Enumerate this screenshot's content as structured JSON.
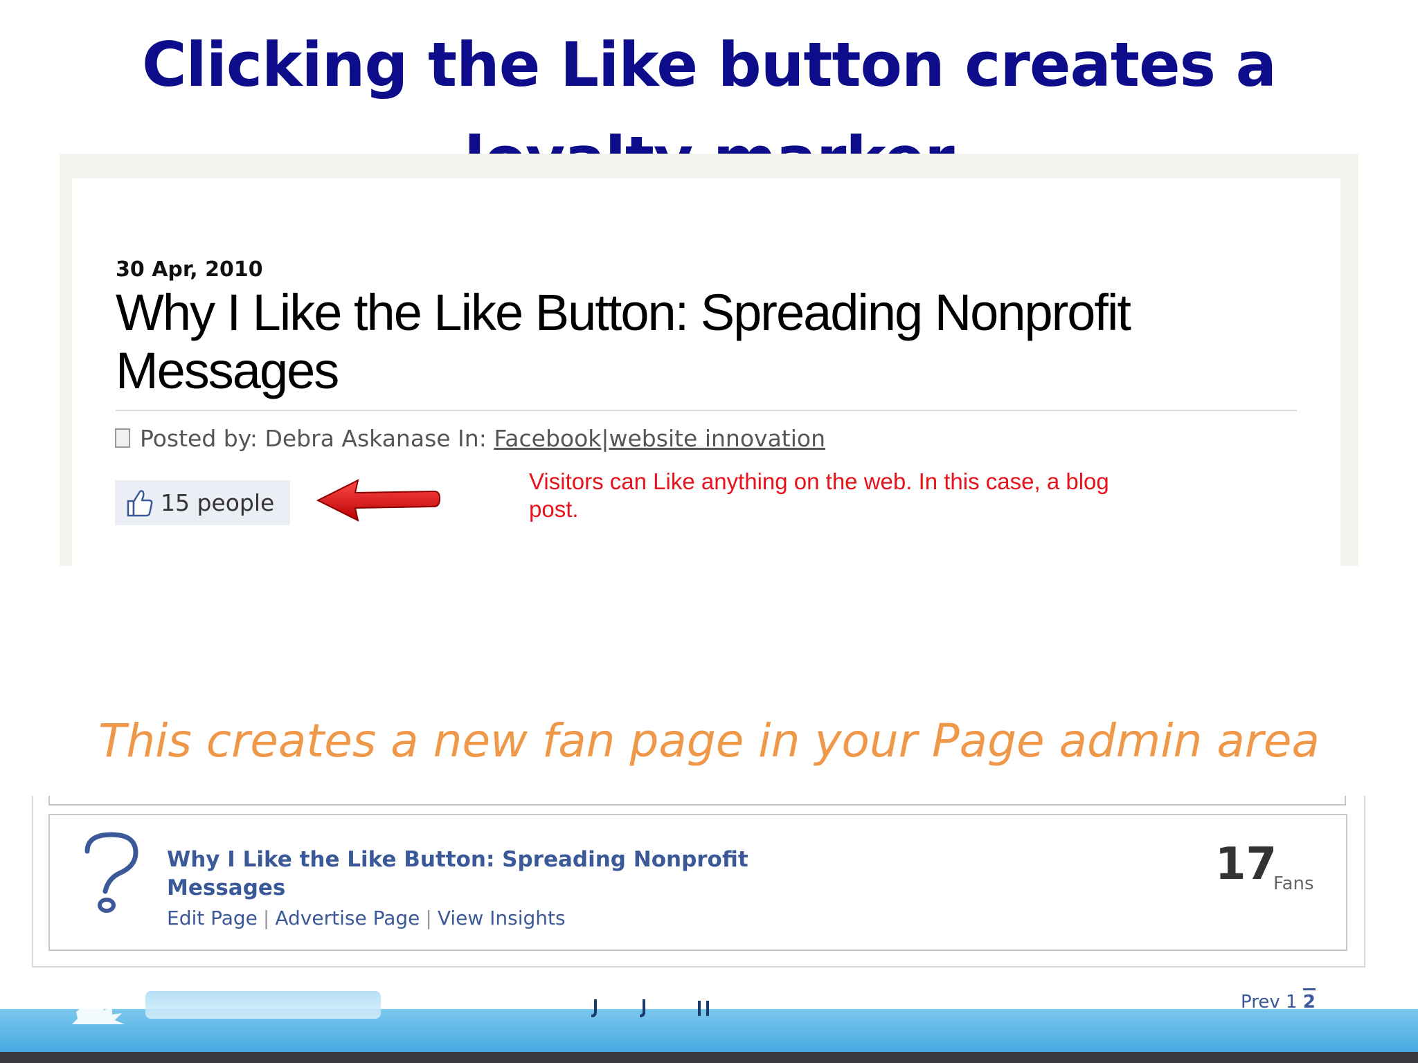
{
  "slide": {
    "title": "Clicking the Like button creates a loyalty marker",
    "subtitle": "This creates a new fan page in your Page admin area"
  },
  "blog_post": {
    "date": "30 Apr, 2010",
    "title": "Why I Like the Like Button: Spreading Nonprofit Messages",
    "posted_by_label": "Posted by: Debra Askanase In:",
    "category_1": "Facebook",
    "category_separator": "|",
    "category_2": "website innovation",
    "like_count_label": "15 people",
    "annotation": "Visitors can Like anything on the web. In this case, a blog post."
  },
  "fan_page": {
    "name": "Why I Like the Like Button: Spreading Nonprofit Messages",
    "links": [
      "Edit Page",
      "Advertise Page",
      "View Insights"
    ],
    "link_separator": "|",
    "fans_count": "17",
    "fans_label": "Fans",
    "pager": {
      "prev": "Prev",
      "page_1": "1",
      "page_2": "2"
    }
  },
  "colors": {
    "title": "#0d0d8c",
    "subtitle": "#f0984a",
    "annotation": "#e8121b",
    "facebook_link": "#3b5998",
    "footer_band": "#45a9e0"
  },
  "icons": {
    "document": "document-icon",
    "thumbs_up": "thumbs-up-icon",
    "arrow": "red-arrow-icon",
    "question_mark": "question-mark-icon"
  }
}
